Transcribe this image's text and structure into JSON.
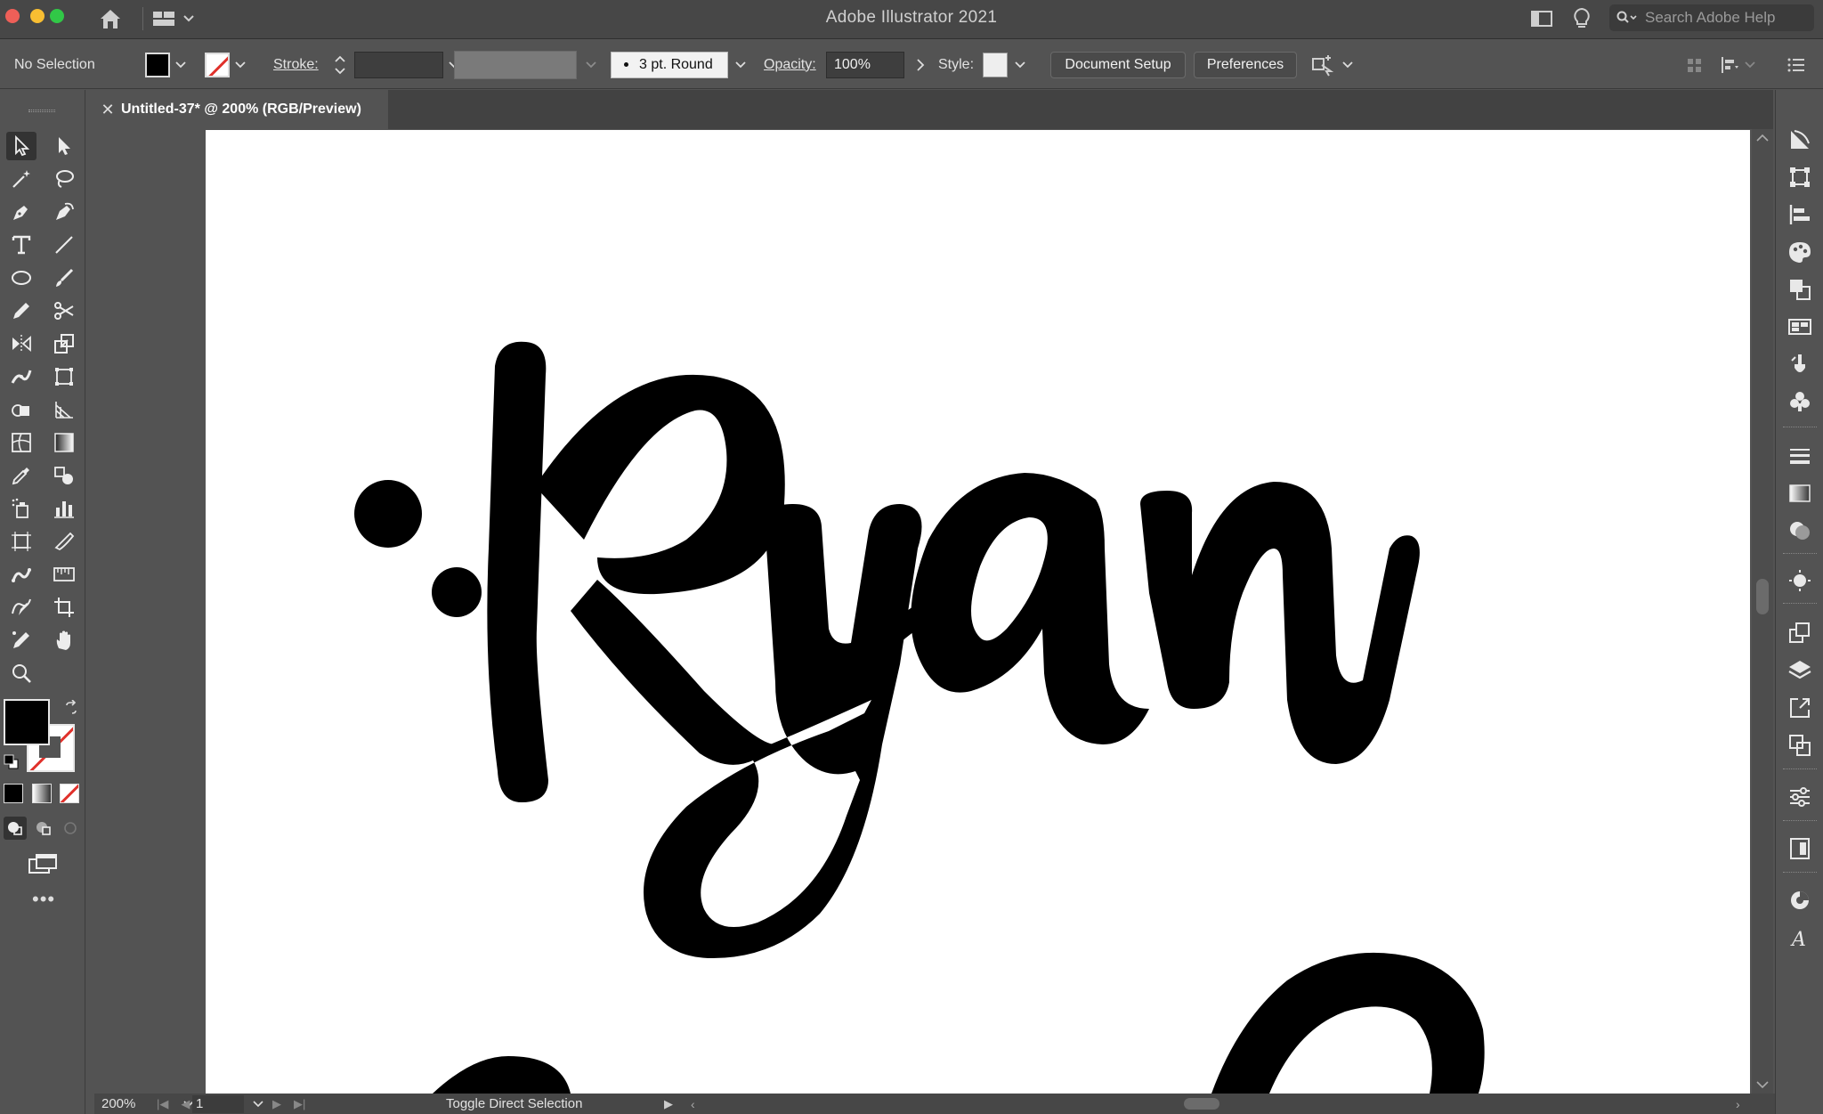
{
  "app": {
    "title": "Adobe Illustrator 2021",
    "search_placeholder": "Search Adobe Help"
  },
  "controlbar": {
    "selection_label": "No Selection",
    "stroke_label": "Stroke:",
    "stroke_weight": "",
    "brush_value": "3 pt. Round",
    "opacity_label": "Opacity:",
    "opacity_value": "100%",
    "style_label": "Style:",
    "document_setup": "Document Setup",
    "preferences": "Preferences"
  },
  "tabs": [
    {
      "label": "Untitled-37* @ 200% (RGB/Preview)",
      "active": true
    }
  ],
  "artwork": {
    "text": "Ryan"
  },
  "statusbar": {
    "zoom": "200%",
    "artboard_number": "1",
    "status_text": "Toggle Direct Selection"
  },
  "colors": {
    "fill": "#000000",
    "stroke": "none",
    "ui_dark": "#535353"
  },
  "toolbar_icons": [
    "selection-tool-icon",
    "direct-selection-tool-icon",
    "magic-wand-tool-icon",
    "lasso-tool-icon",
    "pen-tool-icon",
    "curvature-tool-icon",
    "type-tool-icon",
    "line-segment-tool-icon",
    "ellipse-tool-icon",
    "paintbrush-tool-icon",
    "pencil-tool-icon",
    "scissors-tool-icon",
    "reflect-tool-icon",
    "scale-tool-icon",
    "width-tool-icon",
    "free-transform-tool-icon",
    "shape-builder-tool-icon",
    "perspective-grid-tool-icon",
    "mesh-tool-icon",
    "gradient-tool-icon",
    "eyedropper-tool-icon",
    "blend-tool-icon",
    "symbol-sprayer-tool-icon",
    "column-graph-tool-icon",
    "artboard-tool-icon",
    "slice-tool-icon",
    "puppet-warp-tool-icon",
    "measure-tool-icon",
    "shaper-tool-icon",
    "crop-tool-icon",
    "paint-bucket-tool-icon",
    "hand-tool-icon",
    "zoom-tool-icon"
  ]
}
